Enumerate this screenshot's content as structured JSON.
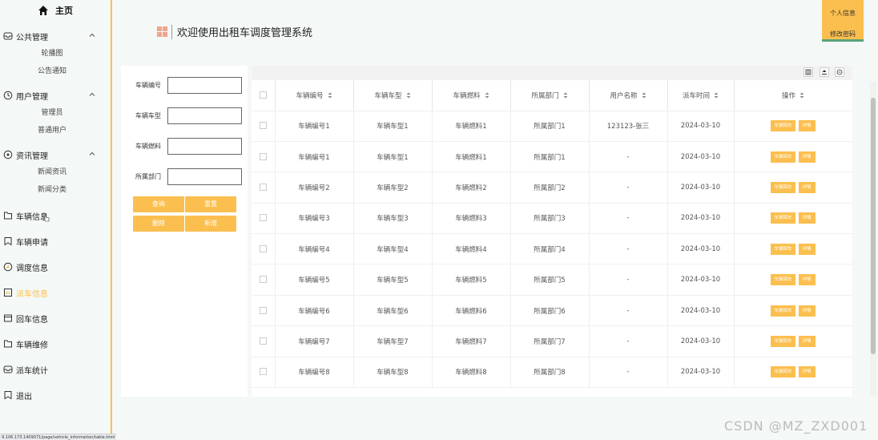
{
  "sidebar": {
    "home": "主页",
    "groups": [
      {
        "label": "公共管理",
        "items": [
          "轮播图",
          "公告通知"
        ]
      },
      {
        "label": "用户管理",
        "items": [
          "管理员",
          "普通用户"
        ]
      },
      {
        "label": "资讯管理",
        "items": [
          "新闻资讯",
          "新闻分类"
        ]
      }
    ],
    "items": [
      "车辆信息",
      "车辆申请",
      "调度信息",
      "派车信息",
      "回车信息",
      "车辆维修",
      "派车统计",
      "退出"
    ],
    "active_color": "#fbbf4f"
  },
  "status_url": "9.106.173.1409071/page/vehicle_information/table.html",
  "header": {
    "title": "欢迎使用出租车调度管理系统",
    "personal_info": "个人信息",
    "change_password": "修改密码"
  },
  "search": {
    "fields": [
      "车辆编号",
      "车辆车型",
      "车辆燃料",
      "所属部门"
    ],
    "buttons": {
      "query": "查询",
      "reset": "重置",
      "delete": "删除",
      "add": "新增"
    }
  },
  "table": {
    "columns": [
      "车辆编号",
      "车辆车型",
      "车辆燃料",
      "所属部门",
      "用户名称",
      "派车时间",
      "操作"
    ],
    "rows": [
      [
        "车辆编号1",
        "车辆车型1",
        "车辆燃料1",
        "所属部门1",
        "123123-张三",
        "2024-03-10"
      ],
      [
        "车辆编号1",
        "车辆车型1",
        "车辆燃料1",
        "所属部门1",
        "-",
        "2024-03-10"
      ],
      [
        "车辆编号2",
        "车辆车型2",
        "车辆燃料2",
        "所属部门2",
        "-",
        "2024-03-10"
      ],
      [
        "车辆编号3",
        "车辆车型3",
        "车辆燃料3",
        "所属部门3",
        "-",
        "2024-03-10"
      ],
      [
        "车辆编号4",
        "车辆车型4",
        "车辆燃料4",
        "所属部门4",
        "-",
        "2024-03-10"
      ],
      [
        "车辆编号5",
        "车辆车型5",
        "车辆燃料5",
        "所属部门5",
        "-",
        "2024-03-10"
      ],
      [
        "车辆编号6",
        "车辆车型6",
        "车辆燃料6",
        "所属部门6",
        "-",
        "2024-03-10"
      ],
      [
        "车辆编号7",
        "车辆车型7",
        "车辆燃料7",
        "所属部门7",
        "-",
        "2024-03-10"
      ],
      [
        "车辆编号8",
        "车辆车型8",
        "车辆燃料8",
        "所属部门8",
        "-",
        "2024-03-10"
      ]
    ],
    "actions": {
      "return": "车辆回车",
      "detail": "详情"
    }
  },
  "watermark": "CSDN @MZ_ZXD001",
  "colors": {
    "accent": "#fbbf4f",
    "green": "#5aa37a"
  }
}
